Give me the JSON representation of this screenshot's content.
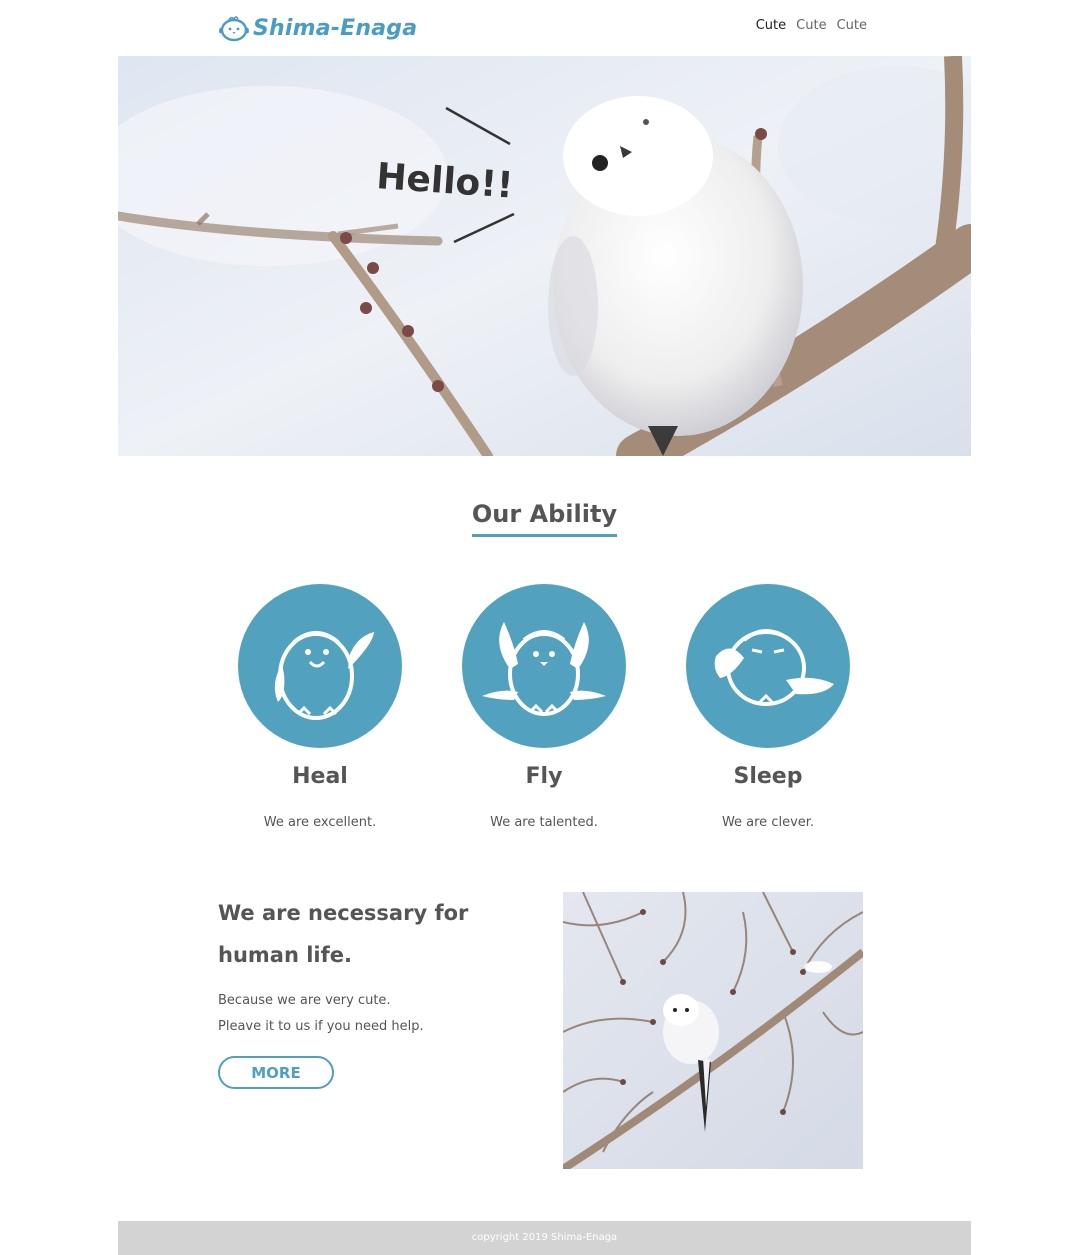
{
  "header": {
    "logo_text": "Shima-Enaga",
    "nav": [
      "Cute",
      "Cute",
      "Cute"
    ]
  },
  "hero": {
    "speech_text": "Hello!!"
  },
  "ability": {
    "title": "Our Ability",
    "items": [
      {
        "title": "Heal",
        "desc": "We are excellent.",
        "icon": "bird-heal-icon"
      },
      {
        "title": "Fly",
        "desc": "We are talented.",
        "icon": "bird-fly-icon"
      },
      {
        "title": "Sleep",
        "desc": "We are clever.",
        "icon": "bird-sleep-icon"
      }
    ]
  },
  "necessary": {
    "heading_line1": "We are necessary for",
    "heading_line2": "human life.",
    "desc_line1": "Because we are very cute.",
    "desc_line2": "Pleave it to us if you need help.",
    "button_label": "MORE"
  },
  "footer": {
    "copyright": "copyright 2019 Shima-Enaga"
  },
  "colors": {
    "accent": "#52a2bf",
    "text": "#555555",
    "footer_bg": "#d3d3d3"
  }
}
